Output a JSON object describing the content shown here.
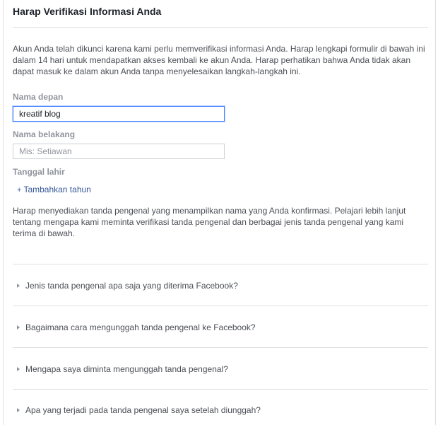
{
  "title": "Harap Verifikasi Informasi Anda",
  "intro": "Akun Anda telah dikunci karena kami perlu memverifikasi informasi Anda. Harap lengkapi formulir di bawah ini dalam 14 hari untuk mendapatkan akses kembali ke akun Anda. Harap perhatikan bahwa Anda tidak akan dapat masuk ke dalam akun Anda tanpa menyelesaikan langkah-langkah ini.",
  "first_name": {
    "label": "Nama depan",
    "value": "kreatif blog"
  },
  "last_name": {
    "label": "Nama belakang",
    "placeholder": "Mis: Setiawan"
  },
  "birthdate": {
    "label": "Tanggal lahir",
    "add_year": "Tambahkan tahun",
    "add_icon": "+"
  },
  "id_text": "Harap menyediakan tanda pengenal yang menampilkan nama yang Anda konfirmasi. Pelajari lebih lanjut tentang mengapa kami meminta verifikasi tanda pengenal dan berbagai jenis tanda pengenal yang kami terima di bawah.",
  "faq": [
    "Jenis tanda pengenal apa saja yang diterima Facebook?",
    "Bagaimana cara mengunggah tanda pengenal ke Facebook?",
    "Mengapa saya diminta mengunggah tanda pengenal?",
    "Apa yang terjadi pada tanda pengenal saya setelah diunggah?"
  ]
}
